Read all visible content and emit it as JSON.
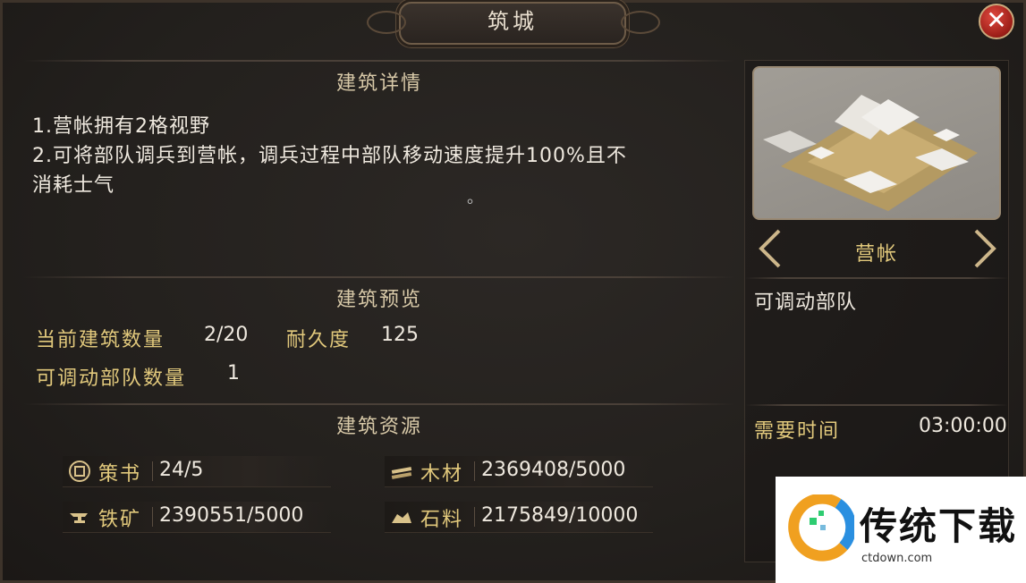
{
  "window": {
    "title": "筑城",
    "close_label": "✕"
  },
  "details": {
    "title": "建筑详情",
    "lines": [
      "1.营帐拥有2格视野",
      "2.可将部队调兵到营帐，调兵过程中部队移动速度提升100%且不",
      "消耗士气"
    ],
    "stray_mark": "。"
  },
  "preview": {
    "title": "建筑预览",
    "count_label": "当前建筑数量",
    "count_value": "2/20",
    "durability_label": "耐久度",
    "durability_value": "125",
    "troops_label": "可调动部队数量",
    "troops_value": "1"
  },
  "resources": {
    "title": "建筑资源",
    "items": [
      {
        "name": "策书",
        "value": "24/5",
        "icon": "strategy-book-icon"
      },
      {
        "name": "木材",
        "value": "2369408/5000",
        "icon": "wood-icon"
      },
      {
        "name": "铁矿",
        "value": "2390551/5000",
        "icon": "iron-anvil-icon"
      },
      {
        "name": "石料",
        "value": "2175849/10000",
        "icon": "stone-icon"
      }
    ]
  },
  "building": {
    "name": "营帐",
    "description": "可调动部队",
    "time_label": "需要时间",
    "time_value": "03:00:00"
  },
  "watermark": {
    "text": "传统下载",
    "sub": "ctdown.com"
  },
  "colors": {
    "accent_gold": "#e2c97c",
    "close_red": "#c0302a"
  }
}
